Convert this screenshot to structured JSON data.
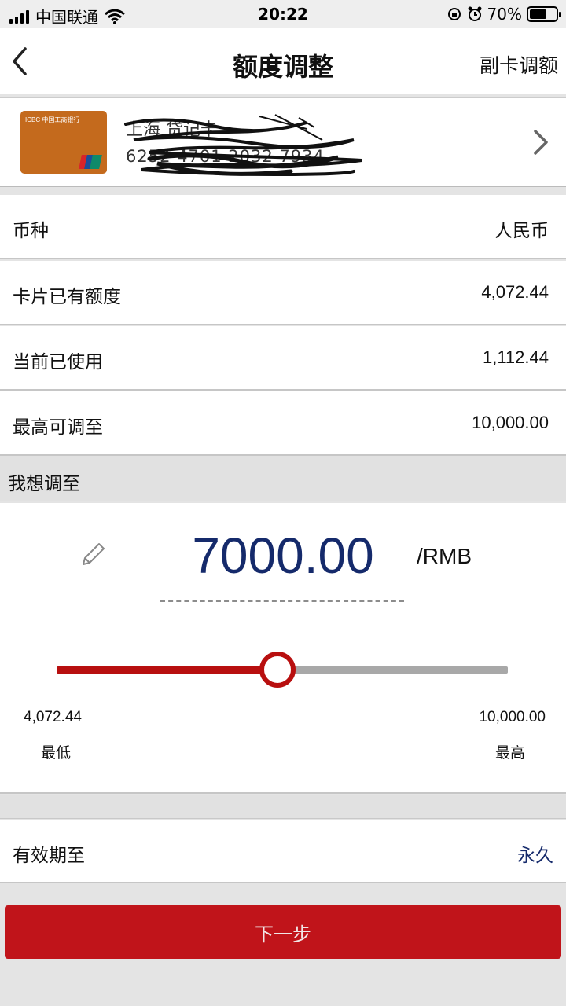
{
  "status_bar": {
    "carrier": "中国联通",
    "time": "20:22",
    "battery_percent": "70%",
    "battery_level": 0.7
  },
  "nav": {
    "title": "额度调整",
    "right_action": "副卡调额",
    "back_icon": "chevron-left-icon"
  },
  "card": {
    "name": "上海 贷记卡",
    "number": "6252 4701 2032 7934",
    "logo_text": "ICBC 中国工商银行"
  },
  "rows": [
    {
      "label": "币种",
      "value": "人民币"
    },
    {
      "label": "卡片已有额度",
      "value": "4,072.44"
    },
    {
      "label": "当前已使用",
      "value": "1,112.44"
    },
    {
      "label": "最高可调至",
      "value": "10,000.00"
    }
  ],
  "adjust": {
    "section_label": "我想调至",
    "amount": "7000.00",
    "unit": "/RMB",
    "min_value": "4,072.44",
    "max_value": "10,000.00",
    "min_label": "最低",
    "max_label": "最高",
    "slider_position": 0.49
  },
  "validity": {
    "label": "有效期至",
    "value": "永久"
  },
  "next_button": "下一步",
  "colors": {
    "accent_red": "#c0141a",
    "amount_blue": "#152a6b"
  }
}
